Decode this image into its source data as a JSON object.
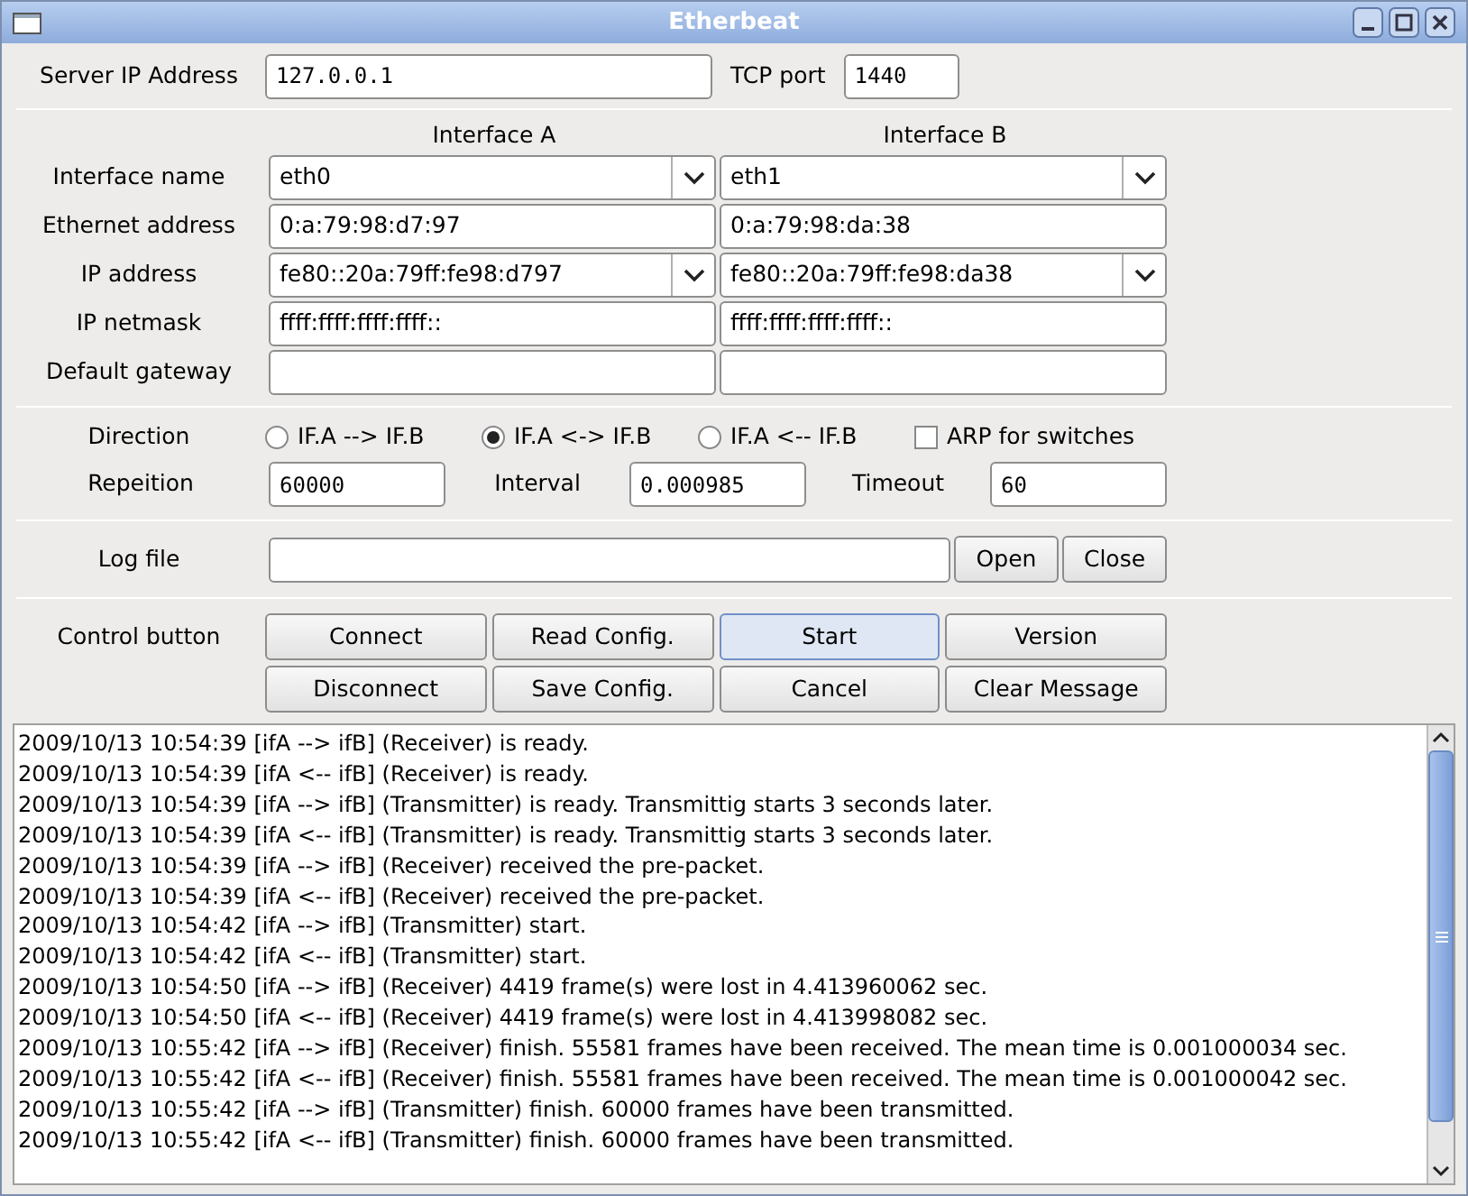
{
  "window": {
    "title": "Etherbeat"
  },
  "server": {
    "label": "Server IP Address",
    "value": "127.0.0.1",
    "port_label": "TCP port",
    "port": "1440"
  },
  "interfaces": {
    "headers": [
      "Interface A",
      "Interface B"
    ],
    "rows": [
      {
        "label": "Interface name",
        "cells": [
          {
            "kind": "combo",
            "value": "eth0"
          },
          {
            "kind": "combo",
            "value": "eth1"
          }
        ]
      },
      {
        "label": "Ethernet address",
        "cells": [
          {
            "kind": "text",
            "value": "0:a:79:98:d7:97"
          },
          {
            "kind": "text",
            "value": "0:a:79:98:da:38"
          }
        ]
      },
      {
        "label": "IP address",
        "cells": [
          {
            "kind": "combo",
            "value": "fe80::20a:79ff:fe98:d797"
          },
          {
            "kind": "combo",
            "value": "fe80::20a:79ff:fe98:da38"
          }
        ]
      },
      {
        "label": "IP netmask",
        "cells": [
          {
            "kind": "text",
            "value": "ffff:ffff:ffff:ffff::"
          },
          {
            "kind": "text",
            "value": "ffff:ffff:ffff:ffff::"
          }
        ]
      },
      {
        "label": "Default gateway",
        "cells": [
          {
            "kind": "text"
          },
          {
            "kind": "text"
          }
        ]
      }
    ]
  },
  "direction": {
    "label": "Direction",
    "options": [
      {
        "label": "IF.A --> IF.B",
        "selected": false
      },
      {
        "label": "IF.A <-> IF.B",
        "selected": true
      },
      {
        "label": "IF.A <-- IF.B",
        "selected": false
      }
    ],
    "arp": {
      "label": "ARP for switches",
      "checked": false
    }
  },
  "timing": [
    {
      "label": "Repeition",
      "value": "60000"
    },
    {
      "label": "Interval",
      "value": "0.000985"
    },
    {
      "label": "Timeout",
      "value": "60"
    }
  ],
  "log_file": {
    "label": "Log file",
    "buttons": [
      "Open",
      "Close"
    ]
  },
  "control": {
    "label": "Control button",
    "buttons": [
      {
        "label": "Connect",
        "focused": false
      },
      {
        "label": "Read Config.",
        "focused": false
      },
      {
        "label": "Start",
        "focused": true
      },
      {
        "label": "Version",
        "focused": false
      },
      {
        "label": "Disconnect",
        "focused": false
      },
      {
        "label": "Save Config.",
        "focused": false
      },
      {
        "label": "Cancel",
        "focused": false
      },
      {
        "label": "Clear Message",
        "focused": false
      }
    ]
  },
  "log": [
    "2009/10/13 10:54:39 [ifA --> ifB] (Receiver) is ready.",
    "2009/10/13 10:54:39 [ifA <-- ifB] (Receiver) is ready.",
    "2009/10/13 10:54:39 [ifA --> ifB] (Transmitter) is ready. Transmittig starts 3 seconds later.",
    "2009/10/13 10:54:39 [ifA <-- ifB] (Transmitter) is ready. Transmittig starts 3 seconds later.",
    "2009/10/13 10:54:39 [ifA --> ifB] (Receiver) received the pre-packet.",
    "2009/10/13 10:54:39 [ifA <-- ifB] (Receiver) received the pre-packet.",
    "2009/10/13 10:54:42 [ifA --> ifB] (Transmitter) start.",
    "2009/10/13 10:54:42 [ifA <-- ifB] (Transmitter) start.",
    "2009/10/13 10:54:50 [ifA --> ifB] (Receiver) 4419 frame(s) were lost in 4.413960062 sec.",
    "2009/10/13 10:54:50 [ifA <-- ifB] (Receiver) 4419 frame(s) were lost in 4.413998082 sec.",
    "2009/10/13 10:55:42 [ifA --> ifB] (Receiver) finish. 55581 frames have been received. The mean time is 0.001000034 sec.",
    "2009/10/13 10:55:42 [ifA <-- ifB] (Receiver) finish. 55581 frames have been received. The mean time is 0.001000042 sec.",
    "2009/10/13 10:55:42 [ifA --> ifB] (Transmitter) finish. 60000 frames have been transmitted.",
    "2009/10/13 10:55:42 [ifA <-- ifB] (Transmitter) finish. 60000 frames have been transmitted."
  ]
}
